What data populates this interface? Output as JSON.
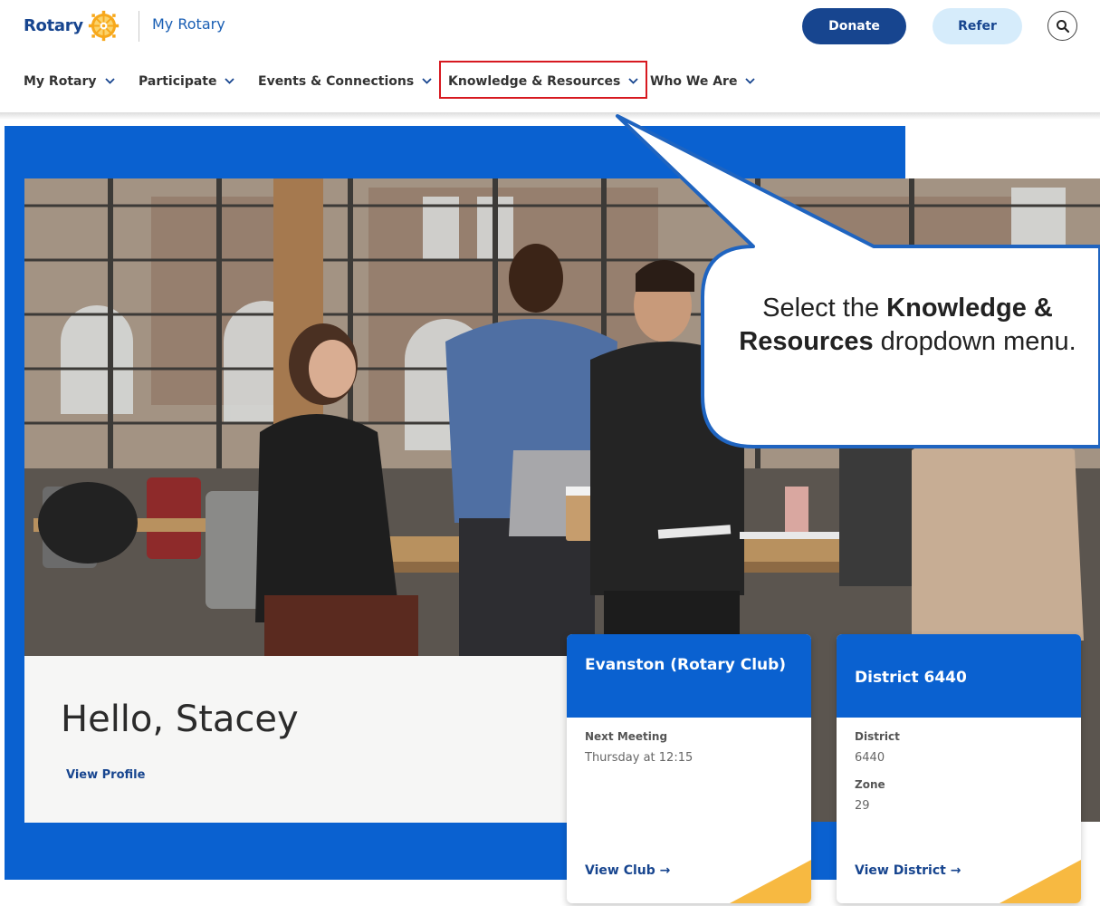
{
  "header": {
    "logo_text": "Rotary",
    "brand_link": "My Rotary",
    "donate_label": "Donate",
    "refer_label": "Refer",
    "search_icon": "search-icon"
  },
  "nav": {
    "items": [
      {
        "label": "My Rotary"
      },
      {
        "label": "Participate"
      },
      {
        "label": "Events & Connections"
      },
      {
        "label": "Knowledge & Resources",
        "highlighted": true
      },
      {
        "label": "Who We Are"
      }
    ]
  },
  "hero": {
    "greeting": "Hello, Stacey",
    "profile_link": "View Profile"
  },
  "cards": [
    {
      "title": "Evanston (Rotary Club)",
      "fields": [
        {
          "label": "Next Meeting",
          "value": "Thursday at 12:15"
        }
      ],
      "link": "View Club →"
    },
    {
      "title": "District 6440",
      "fields": [
        {
          "label": "District",
          "value": "6440"
        },
        {
          "label": "Zone",
          "value": "29"
        }
      ],
      "link": "View District →"
    }
  ],
  "callout": {
    "prefix": "Select the ",
    "bold": "Knowledge & Resources",
    "suffix": " dropdown menu."
  },
  "colors": {
    "rotary_blue": "#17458f",
    "hero_blue": "#0a61d0",
    "gold": "#f7b941",
    "highlight_red": "#d71920"
  }
}
